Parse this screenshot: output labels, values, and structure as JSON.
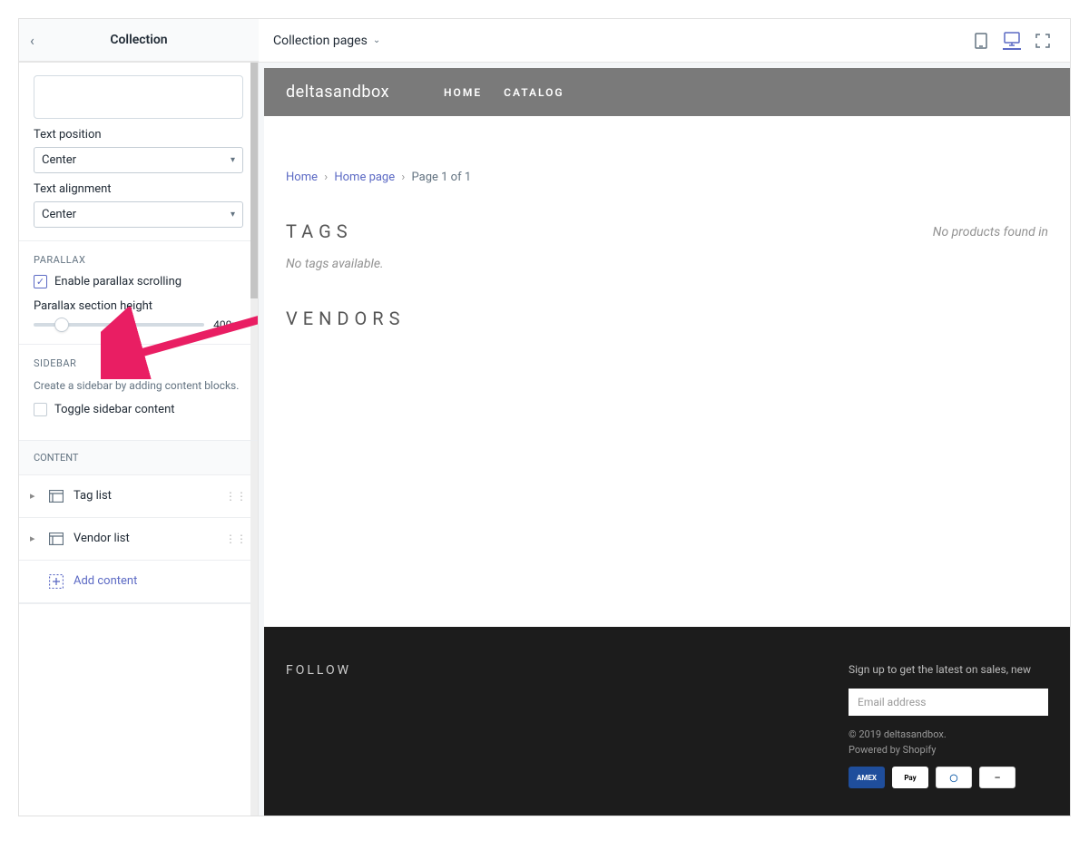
{
  "topbar": {
    "title": "Collection",
    "page_selector": "Collection pages"
  },
  "sidebar": {
    "text_position_label": "Text position",
    "text_position_value": "Center",
    "text_alignment_label": "Text alignment",
    "text_alignment_value": "Center",
    "parallax_heading": "PARALLAX",
    "parallax_checkbox": "Enable parallax scrolling",
    "parallax_height_label": "Parallax section height",
    "parallax_height_value": "400px",
    "sidebar_heading": "SIDEBAR",
    "sidebar_helper": "Create a sidebar by adding content blocks.",
    "toggle_sidebar": "Toggle sidebar content",
    "content_heading": "CONTENT",
    "content_items": [
      {
        "label": "Tag list"
      },
      {
        "label": "Vendor list"
      }
    ],
    "add_content": "Add content"
  },
  "preview": {
    "brand": "deltasandbox",
    "nav": {
      "home": "HOME",
      "catalog": "CATALOG"
    },
    "breadcrumb": {
      "home": "Home",
      "page": "Home page",
      "last": "Page 1 of 1"
    },
    "tags_heading": "TAGS",
    "no_tags": "No tags available.",
    "vendors_heading": "VENDORS",
    "no_products": "No products found in",
    "footer": {
      "follow": "FOLLOW",
      "signup_text": "Sign up to get the latest on sales, new",
      "email_placeholder": "Email address",
      "copyright": "© 2019 deltasandbox.",
      "powered": "Powered by Shopify"
    }
  }
}
